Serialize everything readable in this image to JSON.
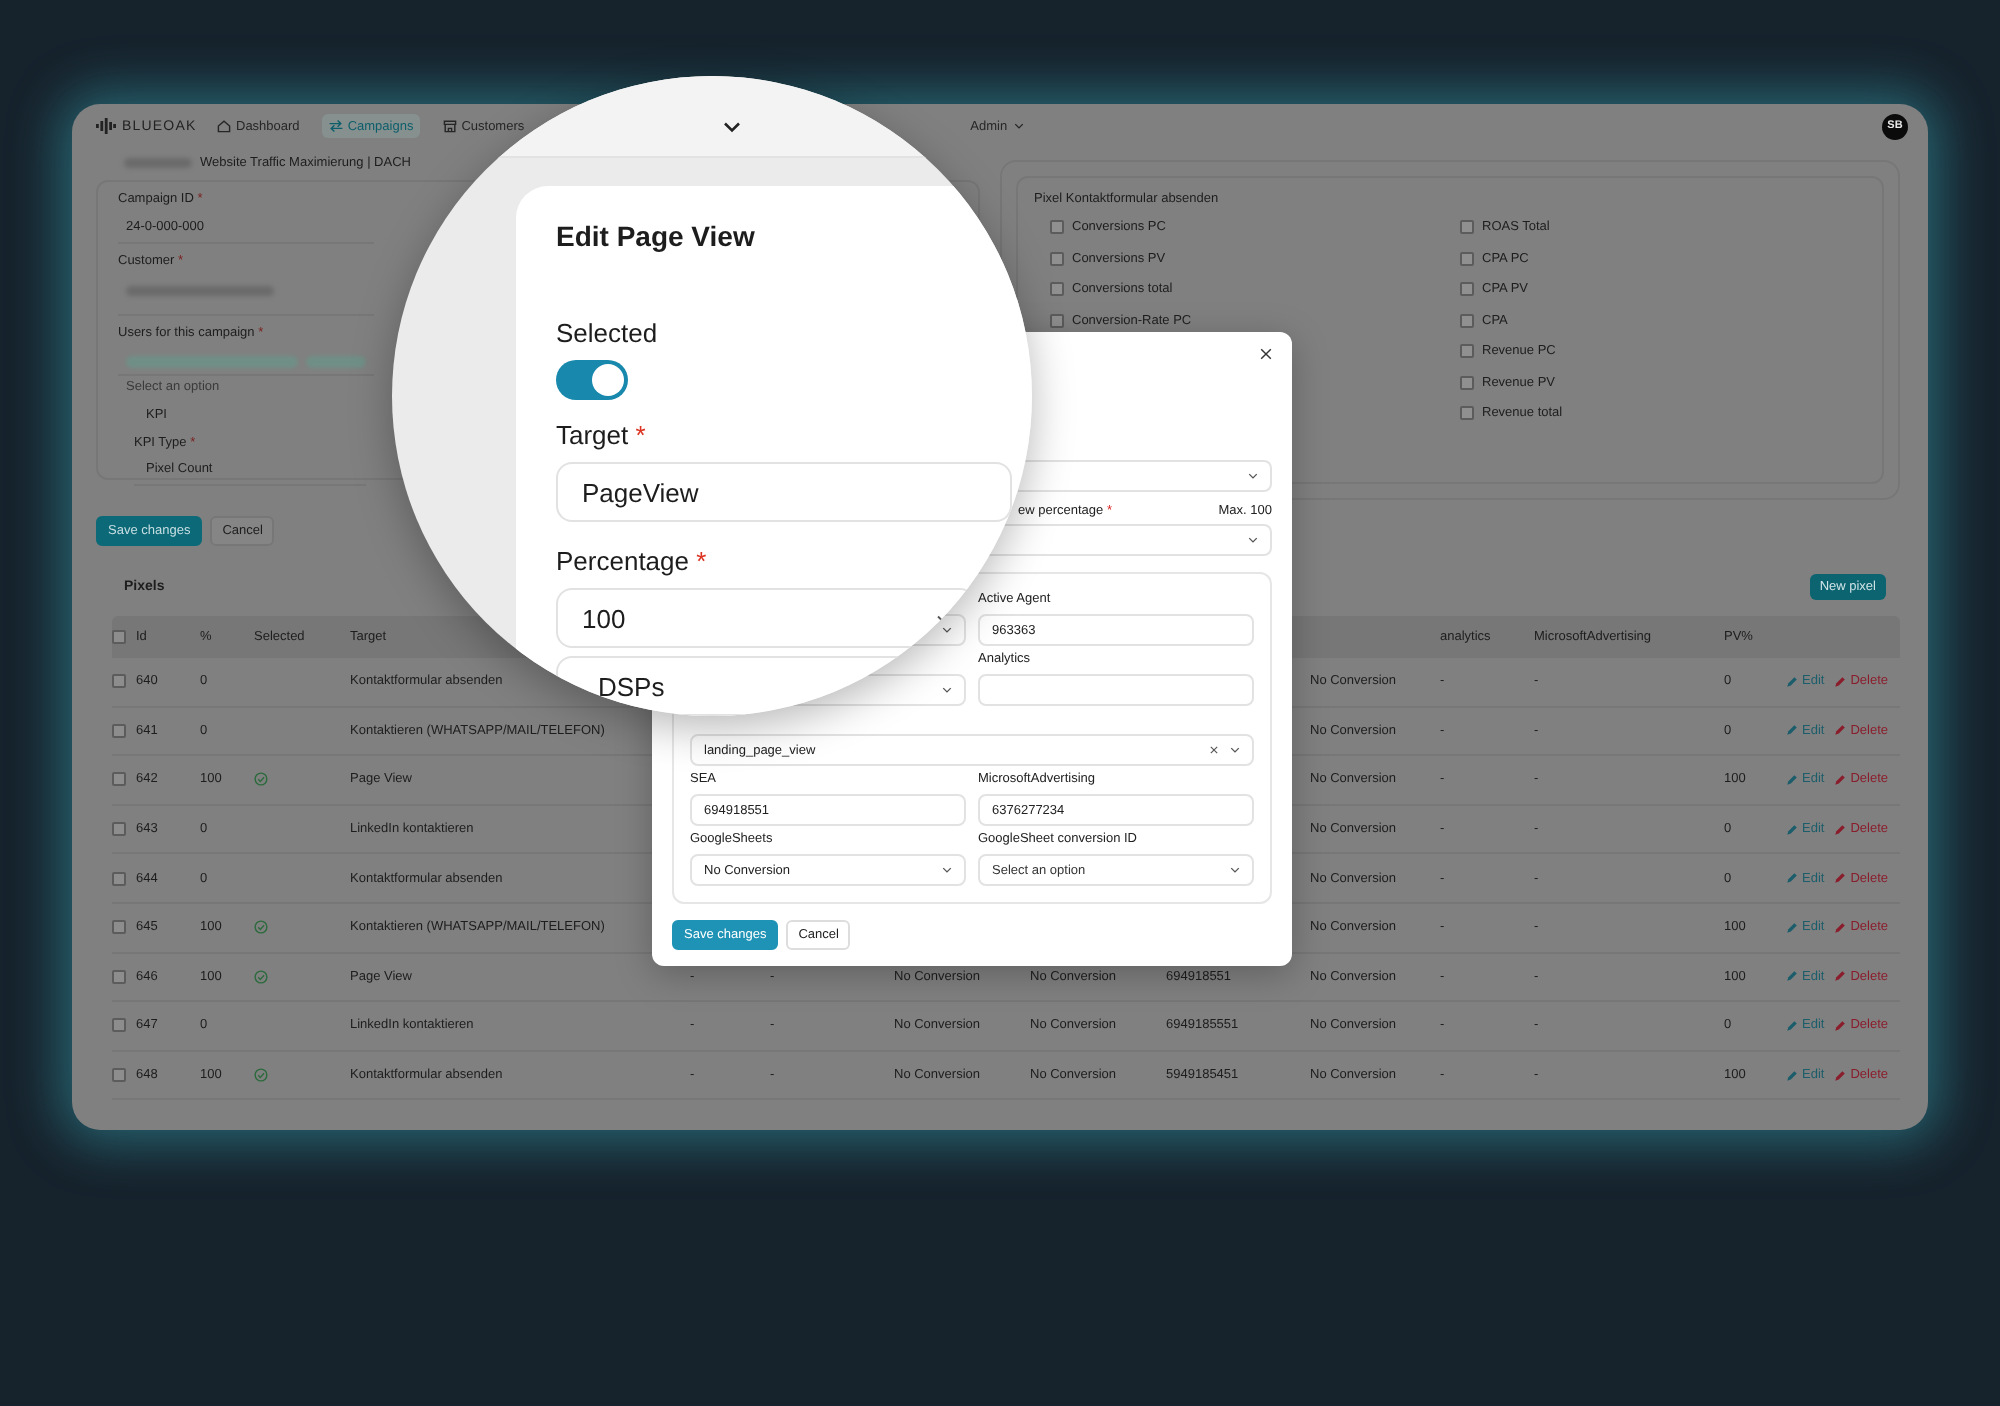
{
  "nav": {
    "logo": "BLUEOAK",
    "items": [
      {
        "label": "Dashboard",
        "selected": false
      },
      {
        "label": "Campaigns",
        "selected": true
      },
      {
        "label": "Customers",
        "selected": false
      }
    ],
    "user_menu": "Admin",
    "avatar": "SB"
  },
  "campaign_form": {
    "name": "Website Traffic Maximierung | DACH",
    "fields": [
      {
        "kind": "text",
        "label": "Campaign ID",
        "required_mark": "*",
        "value": "24-0-000-000"
      },
      {
        "kind": "blurred",
        "label": "Customer",
        "required_mark": "*"
      },
      {
        "kind": "chips",
        "label": "Users for this campaign",
        "required_mark": "*",
        "placeholder": "Select an option"
      }
    ],
    "kpi": {
      "label": "KPI",
      "type_label": "KPI Type",
      "required_mark": "*",
      "type_value": "Pixel Count"
    },
    "buttons": [
      {
        "label": "Save changes",
        "kind": "primary"
      },
      {
        "label": "Cancel",
        "kind": "secondary"
      }
    ]
  },
  "pixel_panel": {
    "title": "Pixel Kontaktformular absenden",
    "left_metrics": [
      {
        "label": "Conversions PC",
        "checked": false
      },
      {
        "label": "Conversions PV",
        "checked": false
      },
      {
        "label": "Conversions total",
        "checked": false
      },
      {
        "label": "Conversion-Rate PC",
        "checked": false
      }
    ],
    "right_metrics": [
      {
        "label": "ROAS Total",
        "checked": false
      },
      {
        "label": "CPA PC",
        "checked": false
      },
      {
        "label": "CPA PV",
        "checked": false
      },
      {
        "label": "CPA",
        "checked": false
      },
      {
        "label": "Revenue PC",
        "checked": false
      },
      {
        "label": "Revenue PV",
        "checked": false
      },
      {
        "label": "Revenue total",
        "checked": false
      }
    ]
  },
  "pixels": {
    "title": "Pixels",
    "new_button": "New pixel",
    "select_all_checked": false,
    "columns_left": [
      "Id",
      "%",
      "Selected",
      "Target"
    ],
    "columns_right": [
      "analytics",
      "MicrosoftAdvertising",
      "PV%"
    ],
    "rows": [
      {
        "checked": false,
        "id": "640",
        "percent": "0",
        "selected": false,
        "target": "Kontaktformular absenden",
        "column_10": "No Conversion",
        "analytics": "-",
        "microsoft_advertising": "-",
        "pv_percent": "0",
        "edit": "Edit",
        "delete": "Delete"
      },
      {
        "checked": false,
        "id": "641",
        "percent": "0",
        "selected": false,
        "target": "Kontaktieren (WHATSAPP/MAIL/TELEFON)",
        "column_10": "No Conversion",
        "analytics": "-",
        "microsoft_advertising": "-",
        "pv_percent": "0",
        "edit": "Edit",
        "delete": "Delete"
      },
      {
        "checked": false,
        "id": "642",
        "percent": "100",
        "selected": true,
        "target": "Page View",
        "column_10": "No Conversion",
        "analytics": "-",
        "microsoft_advertising": "-",
        "pv_percent": "100",
        "edit": "Edit",
        "delete": "Delete"
      },
      {
        "checked": false,
        "id": "643",
        "percent": "0",
        "selected": false,
        "target": "LinkedIn kontaktieren",
        "column_10": "No Conversion",
        "analytics": "-",
        "microsoft_advertising": "-",
        "pv_percent": "0",
        "edit": "Edit",
        "delete": "Delete"
      },
      {
        "checked": false,
        "id": "644",
        "percent": "0",
        "selected": false,
        "target": "Kontaktformular absenden",
        "column_10": "No Conversion",
        "analytics": "-",
        "microsoft_advertising": "-",
        "pv_percent": "0",
        "edit": "Edit",
        "delete": "Delete"
      },
      {
        "checked": false,
        "id": "645",
        "percent": "100",
        "selected": true,
        "target": "Kontaktieren (WHATSAPP/MAIL/TELEFON)",
        "column_10": "No Conversion",
        "analytics": "-",
        "microsoft_advertising": "-",
        "pv_percent": "100",
        "edit": "Edit",
        "delete": "Delete"
      },
      {
        "checked": false,
        "id": "646",
        "percent": "100",
        "selected": true,
        "target": "Page View",
        "column_5": "-",
        "column_6": "-",
        "column_7": "No Conversion",
        "column_8": "No Conversion",
        "column_9": "694918551",
        "column_10": "No Conversion",
        "analytics": "-",
        "microsoft_advertising": "-",
        "pv_percent": "100",
        "edit": "Edit",
        "delete": "Delete"
      },
      {
        "checked": false,
        "id": "647",
        "percent": "0",
        "selected": false,
        "target": "LinkedIn kontaktieren",
        "column_5": "-",
        "column_6": "-",
        "column_7": "No Conversion",
        "column_8": "No Conversion",
        "column_9": "6949185551",
        "column_10": "No Conversion",
        "analytics": "-",
        "microsoft_advertising": "-",
        "pv_percent": "0",
        "edit": "Edit",
        "delete": "Delete"
      },
      {
        "checked": false,
        "id": "648",
        "percent": "100",
        "selected": true,
        "target": "Kontaktformular absenden",
        "column_5": "-",
        "column_6": "-",
        "column_7": "No Conversion",
        "column_8": "No Conversion",
        "column_9": "5949185451",
        "column_10": "No Conversion",
        "analytics": "-",
        "microsoft_advertising": "-",
        "pv_percent": "100",
        "edit": "Edit",
        "delete": "Delete"
      }
    ]
  },
  "edit_modal": {
    "percentage_label": "ew percentage",
    "required_mark": "*",
    "max_hint": "Max. 100",
    "fields": [
      {
        "kind": "select"
      },
      {
        "kind": "input",
        "label": "Active Agent",
        "value": "963363"
      },
      {
        "kind": "select"
      },
      {
        "kind": "input",
        "label": "Analytics"
      },
      {
        "kind": "wide_select",
        "value": "landing_page_view",
        "clearable": true
      },
      {
        "kind": "input",
        "label": "SEA",
        "value": "694918551"
      },
      {
        "kind": "input",
        "label": "MicrosoftAdvertising",
        "value": "6376277234"
      },
      {
        "kind": "select",
        "label": "GoogleSheets",
        "value": "No Conversion"
      },
      {
        "kind": "select",
        "label": "GoogleSheet conversion ID",
        "placeholder": "Select an option"
      }
    ],
    "buttons": [
      {
        "label": "Save changes",
        "kind": "primary"
      },
      {
        "label": "Cancel",
        "kind": "secondary"
      }
    ]
  },
  "magnifier": {
    "title": "Edit Page View",
    "toggle_label": "Selected",
    "toggle_on": true,
    "fields": [
      {
        "kind": "input",
        "label": "Target",
        "required_mark": "*",
        "value": "PageView"
      },
      {
        "kind": "select",
        "label": "Percentage",
        "required_mark": "*",
        "value": "100"
      },
      {
        "kind": "select",
        "value": "DSPs"
      }
    ]
  }
}
